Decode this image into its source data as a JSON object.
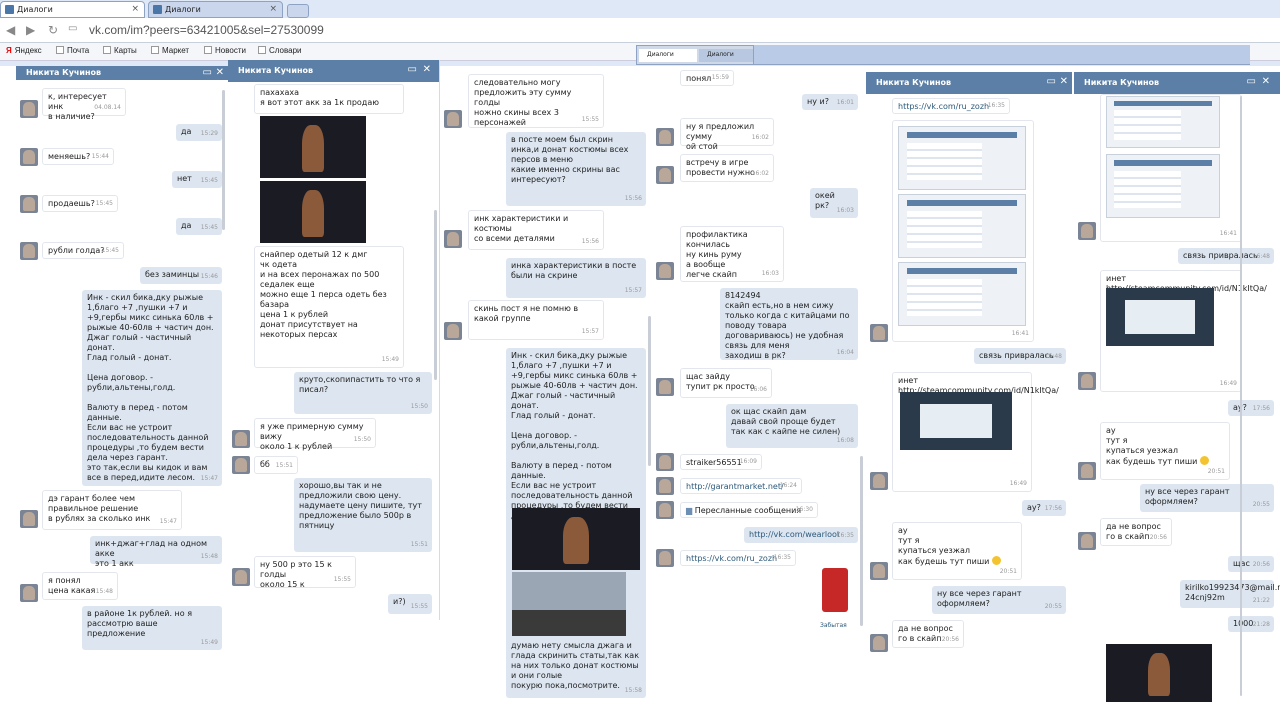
{
  "browser": {
    "tabs": [
      {
        "label": "Диалоги"
      },
      {
        "label": "Диалоги"
      }
    ],
    "url": "vk.com/im?peers=63421005&sel=27530099",
    "bookmarks": [
      "Яндекс",
      "Почта",
      "Карты",
      "Маркет",
      "Новости",
      "Словари"
    ],
    "mini_tabs": [
      "Диалоги",
      "Диалоги"
    ]
  },
  "contact": "Никита Кучинов",
  "p1": {
    "m": [
      [
        "к, интересует инк\nв наличие?",
        "04.08.14"
      ],
      [
        "да",
        "15:29"
      ],
      [
        "меняешь?",
        "15:44"
      ],
      [
        "нет",
        "15:45"
      ],
      [
        "продаешь?",
        "15:45"
      ],
      [
        "да",
        "15:45"
      ],
      [
        "рубли голда?",
        "15:45"
      ],
      [
        "без заминцы",
        "15:46"
      ],
      [
        "Инк - скил бика,дку рыжые 1,благо +7 ,пушки +7 и +9,гербы микс синька 60лв + рыжые 40-60лв + частич дон.\nДжаг голый - частичный донат.\nГлад голый - донат.\n\nЦена договор. -\nрубли,альтены,голд.\n\nВалюту в перед - потом данные.\nЕсли вас не устроит последовательность данной процедуры ,то будем вести дела через гарант.\nэто так,если вы кидок и вам все в перед,идите лесом.",
        "15:47"
      ],
      [
        "дэ гарант более чем правильное решение\nв рублях за сколько инк",
        "15:47"
      ],
      [
        "инк+джаг+глад на одном акке\nэто 1 акк",
        "15:48"
      ],
      [
        "я понял\nцена какая",
        "15:48"
      ],
      [
        "в районе 1к рублей. но я рассмотрю ваше предложение",
        "15:49"
      ]
    ]
  },
  "p2": {
    "m": [
      [
        "пахахаха\nя вот этот акк за 1к продаю",
        ""
      ],
      [
        "снайпер одетый 12 к дмг\nчк одета\nи на всех перонажах по 500 седалек еще\nможно еще 1 перса одеть без базара\nцена 1 к рублей\nдонат присутствует на некоторых персах",
        "15:49"
      ],
      [
        "круто,скопипастить то что я писал?",
        "15:50"
      ],
      [
        "я уже примерную сумму вижу\nоколо 1 к рублей",
        "15:50"
      ],
      [
        "бб",
        "15:51"
      ],
      [
        "хорошо,вы так и не предложили свою цену.\nнадумаете цену пишите, тут предложение было 500р в пятницу",
        "15:51"
      ],
      [
        "ну 500 р это 15 к голды\nоколо 15 к",
        "15:55"
      ],
      [
        "и?)",
        "15:55"
      ]
    ]
  },
  "p3": {
    "m": [
      [
        "следовательно могу предложить эту сумму голды\nножно скины всех 3 персонажей",
        "15:55"
      ],
      [
        "в посте моем был скрин инка,и донат костюмы всех персов в меню\nкакие именно скрины вас интересуют?",
        "15:56"
      ],
      [
        "инк характеристики и костюмы\nсо всеми деталями",
        "15:56"
      ],
      [
        "инка характеристики в посте были на скрине",
        "15:57"
      ],
      [
        "скинь пост я не помню в какой группе",
        "15:57"
      ],
      [
        "Инк - скил бика,дку рыжые 1,благо +7 ,пушки +7 и +9,гербы микс синька 60лв + рыжые 40-60лв + частич дон.\nДжаг голый - частичный донат.\nГлад голый - донат.\n\nЦена договор. -\nрубли,альтены,голд.\n\nВалюту в перед - потом данные.\nЕсли вас не устроит последовательность данной процедуры ,то будем вести дела через гарант.",
        ""
      ],
      [
        "думаю нету смысла джага и глада скринить статы,так как на них только донат костюмы и они голые\nпокурю пока,посмотрите.",
        "15:58"
      ]
    ]
  },
  "p4": {
    "m": [
      [
        "понял",
        "15:59"
      ],
      [
        "ну и?",
        "16:01"
      ],
      [
        "ну я предложил сумму\nой стой",
        "16:02"
      ],
      [
        "встречу в игре\nпровести нужно",
        "16:02"
      ],
      [
        "окей\nрк?",
        "16:03"
      ],
      [
        "профилактика кончилась\nну кинь руму\nа вообще\nлегче скайп",
        "16:03"
      ],
      [
        "8142494\nскайп есть,но в нем сижу только когда с китайцами по поводу товара договариваюсь) не удобная связь для меня\nзаходиш в рк?",
        "16:04"
      ],
      [
        "щас зайду\nтупит рк просто",
        "16:06"
      ],
      [
        "ок щас скайп дам\nдавай свой проще будет\nтак как с кайпе не силен)",
        "16:08"
      ],
      [
        "straiker56551",
        "16:09"
      ],
      [
        "http://garantmarket.net/",
        "16:24"
      ],
      [
        "Пересланные сообщения",
        "16:30"
      ],
      [
        "http://vk.com/wearloot",
        "16:35"
      ],
      [
        "https://vk.com/ru_zozh",
        "16:35"
      ],
      [
        "Забытая",
        ""
      ]
    ]
  },
  "p5": {
    "m": [
      [
        "https://vk.com/ru_zozh",
        "16:35"
      ],
      [
        "",
        "16:41"
      ],
      [
        "связь привралась",
        "16:48"
      ],
      [
        "инет\nhttp://steamcommunity.com/id/N1kItQa/",
        "16:49"
      ],
      [
        "ау?",
        "17:56"
      ],
      [
        "ау\nтут я\nкупаться уезжал\nкак будешь тут пиши",
        "20:51"
      ],
      [
        "ну все через гарант оформляем?",
        "20:55"
      ],
      [
        "да не вопрос\nго в скайп",
        "20:56"
      ]
    ]
  },
  "p6": {
    "m": [
      [
        "",
        "16:41"
      ],
      [
        "связь привралась",
        "16:48"
      ],
      [
        "инет\nhttp://steamcommunity.com/id/N1kItQa/",
        "16:49"
      ],
      [
        "ау?",
        "17:56"
      ],
      [
        "ау\nтут я\nкупаться уезжал\nкак будешь тут пиши",
        "20:51"
      ],
      [
        "ну все через гарант оформляем?",
        "20:55"
      ],
      [
        "да не вопрос\nго в скайп",
        "20:56"
      ],
      [
        "щас",
        "20:56"
      ],
      [
        "kirilko19923473@mail.ru\n24cnj92m",
        "21:22"
      ],
      [
        "1000",
        "21:28"
      ]
    ]
  }
}
